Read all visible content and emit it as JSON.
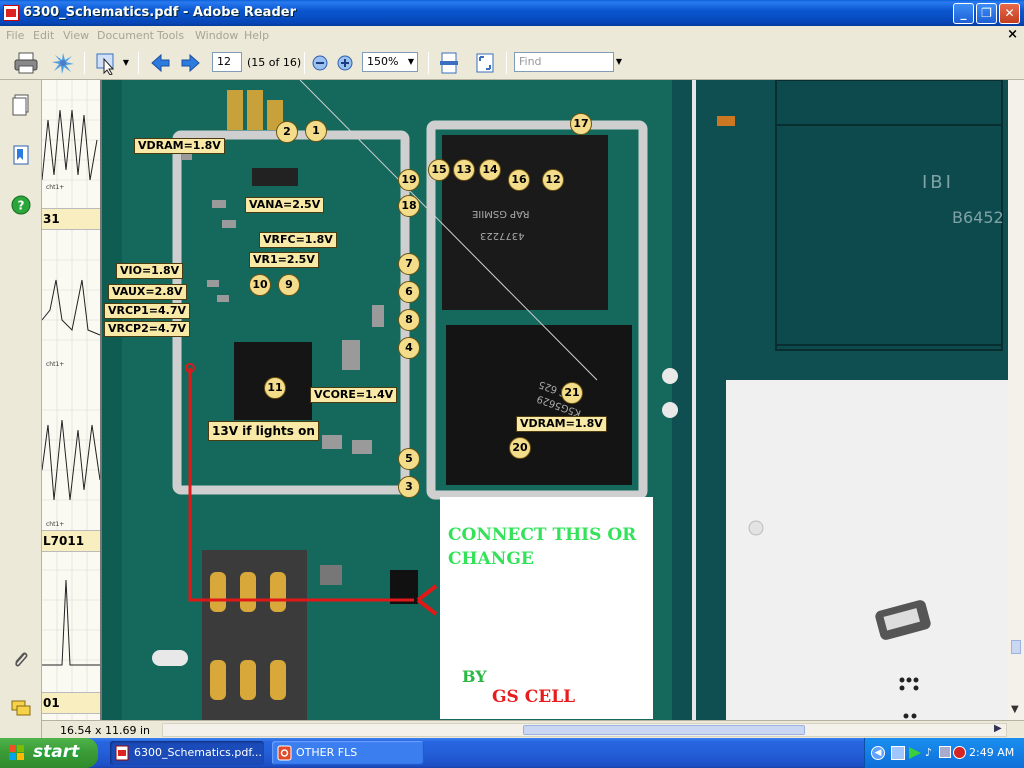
{
  "window": {
    "title": "6300_Schematics.pdf - Adobe Reader",
    "minimize_label": "_",
    "maximize_label": "❐",
    "close_label": "✕"
  },
  "menubar": {
    "items": [
      "File",
      "Edit",
      "View",
      "Document",
      "Tools",
      "Window",
      "Help"
    ],
    "doc_close": "×"
  },
  "toolbar": {
    "page_number": "12",
    "page_count": "(15 of 16)",
    "zoom": "150%",
    "find_placeholder": "Find"
  },
  "status": {
    "page_size": "16.54 x 11.69 in"
  },
  "thumbnail_strip": {
    "labels": [
      "31",
      "L7011",
      "01"
    ],
    "chart_caption": "cht1+"
  },
  "board_labels": {
    "vdram_top": "VDRAM=1.8V",
    "vana": "VANA=2.5V",
    "vrfc": "VRFC=1.8V",
    "vr1": "VR1=2.5V",
    "vio": "VIO=1.8V",
    "vaux": "VAUX=2.8V",
    "vrcp1": "VRCP1=4.7V",
    "vrcp2": "VRCP2=4.7V",
    "vcore": "VCORE=1.4V",
    "lights": "13V if lights on",
    "vdram_bottom": "VDRAM=1.8V",
    "numbers": [
      "1",
      "2",
      "3",
      "4",
      "5",
      "6",
      "7",
      "8",
      "9",
      "10",
      "11",
      "12",
      "13",
      "14",
      "15",
      "16",
      "17",
      "18",
      "19",
      "20",
      "21"
    ]
  },
  "chip_text": {
    "cpu": "RAP GSMIIE",
    "cpu2": "4377223",
    "mem": "SEC 625",
    "mem2": "K5G5629",
    "ibi": "IBI",
    "part": "B6452"
  },
  "annotation": {
    "line1": "CONNECT THIS OR",
    "line2": "CHANGE",
    "by": "BY",
    "brand": "GS CELL"
  },
  "taskbar": {
    "start_label": "start",
    "tasks": [
      {
        "label": "6300_Schematics.pdf...",
        "active": true
      },
      {
        "label": "OTHER FLS",
        "active": false
      }
    ],
    "clock": "2:49 AM"
  },
  "colors": {
    "pcb": "#0e5c52",
    "annotation_green": "#34e25a",
    "annotation_red": "#e81c1c",
    "wire_red": "#e01818"
  }
}
